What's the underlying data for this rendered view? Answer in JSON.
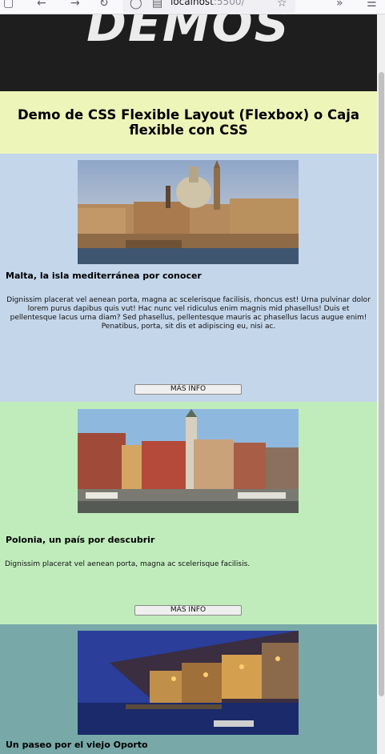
{
  "browser": {
    "url_host": "localhost",
    "url_port": ":5500/",
    "icons": {
      "back": "back-arrow-icon",
      "forward": "forward-arrow-icon",
      "reload": "reload-icon",
      "shield": "shield-icon",
      "page": "page-icon",
      "bookmark": "star-icon",
      "overflow": "chevron-double-right-icon",
      "menu": "hamburger-menu-icon"
    }
  },
  "hero": {
    "title": "DEMOS"
  },
  "heading": {
    "text": "Demo de CSS Flexible Layout (Flexbox) o Caja flexible con CSS"
  },
  "cards": [
    {
      "title": "Malta, la isla mediterránea por conocer",
      "text": "Dignissim placerat vel aenean porta, magna ac scelerisque facilisis, rhoncus est! Urna pulvinar dolor lorem purus dapibus quis vut! Hac nunc vel ridiculus enim magnis mid phasellus! Duis et pellentesque lacus urna diam? Sed phasellus, pellentesque mauris ac phasellus lacus augue enim! Penatibus, porta, sit dis et adipiscing eu, nisi ac.",
      "button": "MÁS INFO",
      "color": "#c4d6ea"
    },
    {
      "title": "Polonia, un país por descubrir",
      "text": "Dignissim placerat vel aenean porta, magna ac scelerisque facilisis.",
      "button": "MÁS INFO",
      "color": "#c0ecbc"
    },
    {
      "title": "Un paseo por el viejo Oporto",
      "color": "#78a8a8"
    }
  ]
}
